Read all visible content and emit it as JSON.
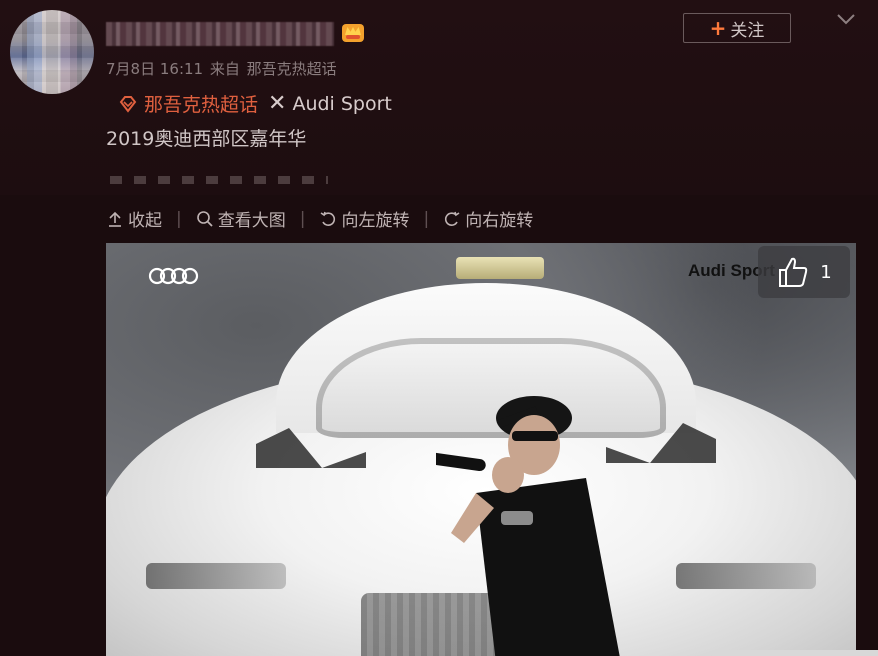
{
  "post": {
    "date": "7月8日 16:11",
    "source_prefix": "来自",
    "source": "那吾克热超话",
    "follow_label": "关注",
    "follow_plus": "+",
    "topic_label": "那吾克热超话",
    "collab_x": "✕",
    "brand_label": "Audi Sport",
    "body_text": "2019奥迪西部区嘉年华"
  },
  "toolbar": {
    "collapse": "收起",
    "view_large": "查看大图",
    "rotate_left": "向左旋转",
    "rotate_right": "向右旋转",
    "separator": "|"
  },
  "image": {
    "watermark_brand": "Audi Sport",
    "like_count": "1"
  },
  "colors": {
    "background": "#1a0c0e",
    "accent": "#e0603f",
    "text": "#c9bcbc"
  },
  "icons": [
    "crown-icon",
    "chevron-down-icon",
    "topic-icon",
    "collapse-icon",
    "search-icon",
    "rotate-left-icon",
    "rotate-right-icon",
    "thumbs-up-icon",
    "audi-rings-logo"
  ]
}
